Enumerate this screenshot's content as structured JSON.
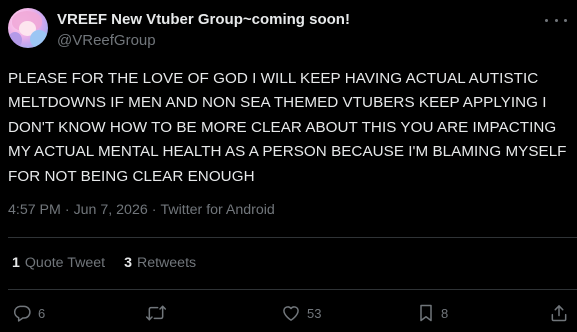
{
  "user": {
    "display_name": "VREEF New Vtuber Group~coming soon!",
    "handle": "@VReefGroup"
  },
  "tweet": {
    "text": "PLEASE FOR THE LOVE OF GOD I WILL KEEP HAVING ACTUAL AUTISTIC MELTDOWNS IF MEN AND NON SEA THEMED VTUBERS KEEP APPLYING I DON'T KNOW HOW TO BE MORE CLEAR ABOUT THIS YOU ARE IMPACTING MY ACTUAL MENTAL HEALTH AS A PERSON BECAUSE I'M BLAMING MYSELF FOR NOT BEING CLEAR ENOUGH",
    "time": "4:57 PM",
    "separator": "·",
    "date": "Jun 7, 2026",
    "source": "Twitter for Android"
  },
  "stats": {
    "quote_count": "1",
    "quote_label": "Quote Tweet",
    "retweet_count": "3",
    "retweet_label": "Retweets"
  },
  "actions": {
    "reply_count": "6",
    "retweet_icon": "retweet-icon",
    "like_count": "53",
    "bookmark_count": "8",
    "reply_icon": "reply-icon",
    "like_icon": "heart-icon",
    "bookmark_icon": "bookmark-icon",
    "share_icon": "share-icon"
  },
  "colors": {
    "background": "#000000",
    "text": "#e7e9ea",
    "muted": "#71767b",
    "divider": "#2f3336"
  }
}
